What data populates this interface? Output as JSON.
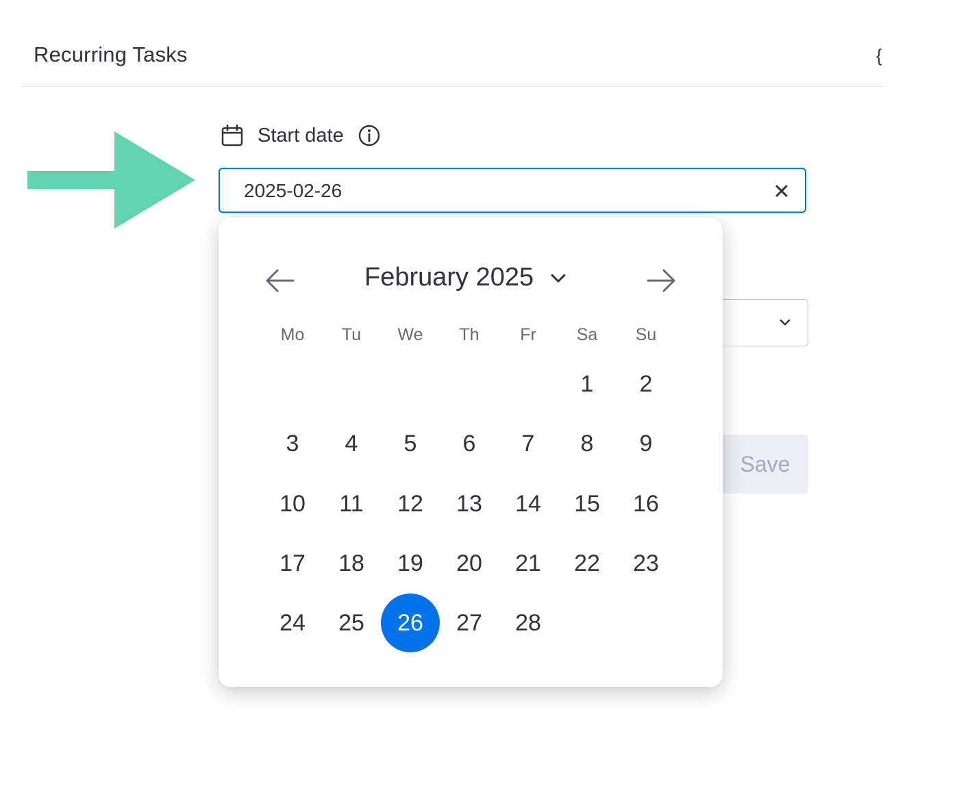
{
  "header": {
    "title": "Recurring Tasks",
    "edge_icon_glyph": "{"
  },
  "field": {
    "label": "Start date",
    "calendar_icon": "calendar-icon",
    "info_icon": "info-icon",
    "value": "2025-02-26",
    "clear_icon": "close-icon"
  },
  "background_form": {
    "select_icon": "chevron-down-icon",
    "save_label": "Save"
  },
  "datepicker": {
    "month_label": "February 2025",
    "prev_icon": "arrow-left-icon",
    "next_icon": "arrow-right-icon",
    "month_dropdown_icon": "chevron-down-icon",
    "weekdays": [
      "Mo",
      "Tu",
      "We",
      "Th",
      "Fr",
      "Sa",
      "Su"
    ],
    "first_weekday_index": 5,
    "days": [
      "1",
      "2",
      "3",
      "4",
      "5",
      "6",
      "7",
      "8",
      "9",
      "10",
      "11",
      "12",
      "13",
      "14",
      "15",
      "16",
      "17",
      "18",
      "19",
      "20",
      "21",
      "22",
      "23",
      "24",
      "25",
      "26",
      "27",
      "28"
    ],
    "selected_day": "26"
  },
  "colors": {
    "accent": "#0073ea",
    "pointer_arrow": "#5fd4ae",
    "text": "#323338",
    "muted": "#676879"
  }
}
